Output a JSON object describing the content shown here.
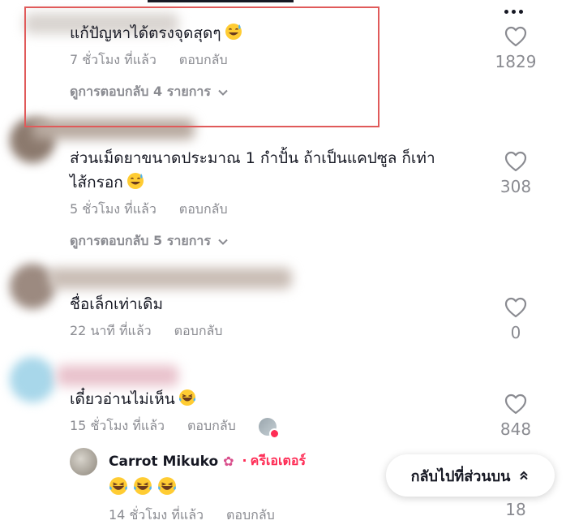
{
  "comments": [
    {
      "text": "แก้ปัญหาได้ตรงจุดสุดๆ",
      "time": "7 ชั่วโมง ที่แล้ว",
      "reply": "ตอบกลับ",
      "view_replies": "ดูการตอบกลับ 4 รายการ",
      "likes": "1829",
      "emoji": "sweat-smile-emoji"
    },
    {
      "text_line1": "ส่วนเม็ดยาขนาดประมาณ 1 กำปั้น ถ้าเป็นแคปซูล ก็เท่า",
      "text_line2": "ไส้กรอก",
      "time": "5 ชั่วโมง ที่แล้ว",
      "reply": "ตอบกลับ",
      "view_replies": "ดูการตอบกลับ 5 รายการ",
      "likes": "308",
      "emoji": "sweat-smile-emoji"
    },
    {
      "text": "ชื่อเล็กเท่าเดิม",
      "time": "22 นาที ที่แล้ว",
      "reply": "ตอบกลับ",
      "likes": "0"
    },
    {
      "text": "เดี๋ยวอ่านไม่เห็น",
      "time": "15 ชั่วโมง ที่แล้ว",
      "reply": "ตอบกลับ",
      "likes": "848",
      "emoji": "laughing-tears-emoji"
    }
  ],
  "creator_reply": {
    "name": "Carrot Mikuko",
    "name_icon": "tulip-emoji",
    "badge": "ครีเอเตอร์",
    "emojis": [
      "laughing-tears-emoji",
      "laughing-tears-emoji",
      "laughing-tears-emoji"
    ],
    "time": "14 ชั่วโมง ที่แล้ว",
    "reply": "ตอบกลับ",
    "likes": "18"
  },
  "back_to_top": "กลับไปที่ส่วนบน",
  "colors": {
    "text": "#161823",
    "muted": "#8a8b91",
    "accent": "#fe2c55",
    "highlight": "#e05a5a"
  }
}
